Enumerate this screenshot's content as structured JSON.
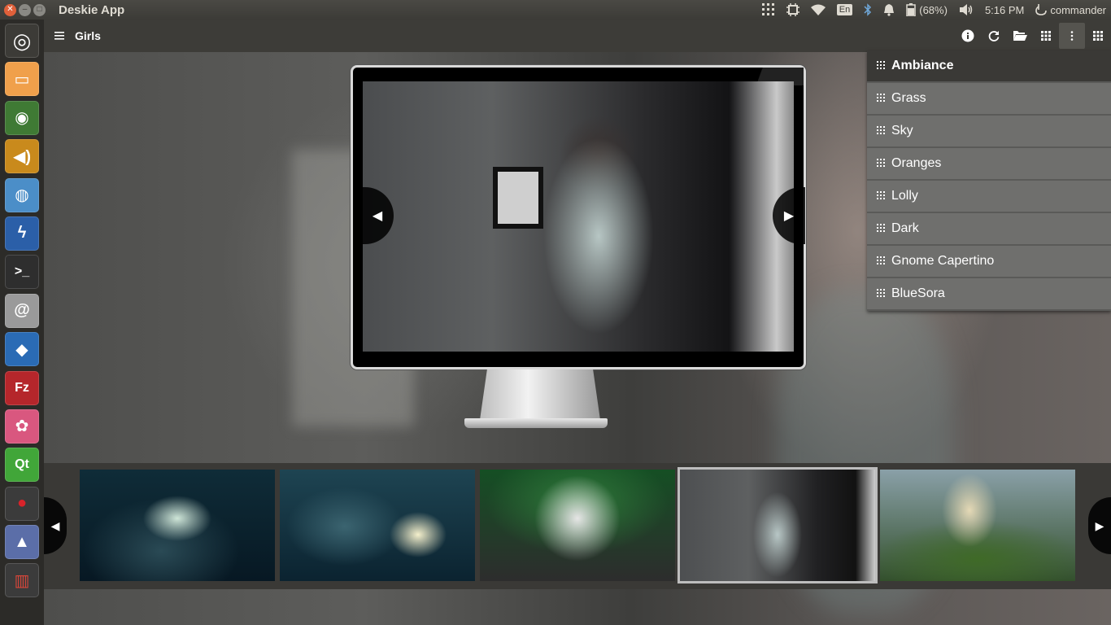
{
  "topbar": {
    "app_title": "Deskie App",
    "keyboard_layout": "En",
    "battery": "(68%)",
    "time": "5:16 PM",
    "user": "commander"
  },
  "toolbar": {
    "title": "Girls"
  },
  "themes": {
    "items": [
      {
        "label": "Ambiance",
        "selected": true
      },
      {
        "label": "Grass"
      },
      {
        "label": "Sky"
      },
      {
        "label": "Oranges"
      },
      {
        "label": "Lolly"
      },
      {
        "label": "Dark"
      },
      {
        "label": "Gnome Capertino"
      },
      {
        "label": "BlueSora"
      }
    ]
  },
  "launcher": {
    "items": [
      {
        "icon": "ubuntu-dash-icon",
        "color": "#3c3b37"
      },
      {
        "icon": "files-icon",
        "color": "#f0a04b"
      },
      {
        "icon": "eye-settings-icon",
        "color": "#3f7a34"
      },
      {
        "icon": "sound-icon",
        "color": "#c98a1c"
      },
      {
        "icon": "chromium-icon",
        "color": "#4b8ec8"
      },
      {
        "icon": "weather-icon",
        "color": "#2b5fa8"
      },
      {
        "icon": "terminal-icon",
        "color": "#2e2e2e"
      },
      {
        "icon": "mail-icon",
        "color": "#9a9a9a"
      },
      {
        "icon": "fish-icon",
        "color": "#2a6bb5"
      },
      {
        "icon": "filezilla-icon",
        "color": "#b5262b"
      },
      {
        "icon": "pink-app-icon",
        "color": "#d9577f"
      },
      {
        "icon": "qt-icon",
        "color": "#41a639"
      },
      {
        "icon": "cherry-icon",
        "color": "#3b3b3b"
      },
      {
        "icon": "deskie-icon",
        "color": "#5b6ea8"
      },
      {
        "icon": "trash-icon",
        "color": "#3b3b3b"
      }
    ]
  },
  "colors": {
    "accent": "#e0603a",
    "panel": "#3c3b37",
    "menu_item": "#6f6f6d"
  }
}
